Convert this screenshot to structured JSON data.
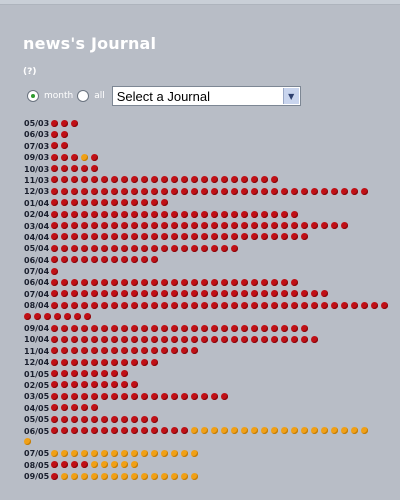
{
  "journal": {
    "title": "news's Journal",
    "help_link": "(?)",
    "filter": {
      "month_label": "month",
      "all_label": "all",
      "selected": "month"
    },
    "select": {
      "value": "Select a Journal"
    }
  },
  "colors": {
    "red": "#c01016",
    "orange": "#f0a016",
    "background": "#b8bdc6"
  },
  "rows": [
    {
      "date": "05/03",
      "red": 3,
      "orange": 0
    },
    {
      "date": "06/03",
      "red": 2,
      "orange": 0
    },
    {
      "date": "07/03",
      "red": 2,
      "orange": 0
    },
    {
      "date": "09/03",
      "red": 3,
      "orange": 1,
      "after_red": 1
    },
    {
      "date": "10/03",
      "red": 5,
      "orange": 0
    },
    {
      "date": "11/03",
      "red": 23,
      "orange": 0
    },
    {
      "date": "12/03",
      "red": 32,
      "orange": 0
    },
    {
      "date": "01/04",
      "red": 12,
      "orange": 0
    },
    {
      "date": "02/04",
      "red": 25,
      "orange": 0
    },
    {
      "date": "03/04",
      "red": 30,
      "orange": 0
    },
    {
      "date": "04/04",
      "red": 26,
      "orange": 0
    },
    {
      "date": "05/04",
      "red": 19,
      "orange": 0
    },
    {
      "date": "06/04",
      "red": 11,
      "orange": 0
    },
    {
      "date": "07/04",
      "red": 1,
      "orange": 0
    },
    {
      "date": "06/04",
      "red": 25,
      "orange": 0
    },
    {
      "date": "07/04",
      "red": 28,
      "orange": 0
    },
    {
      "date": "08/04",
      "red": 34,
      "orange": 0,
      "wrap_red": 7
    },
    {
      "date": "09/04",
      "red": 26,
      "orange": 0
    },
    {
      "date": "10/04",
      "red": 27,
      "orange": 0
    },
    {
      "date": "11/04",
      "red": 15,
      "orange": 0
    },
    {
      "date": "12/04",
      "red": 11,
      "orange": 0
    },
    {
      "date": "01/05",
      "red": 8,
      "orange": 0
    },
    {
      "date": "02/05",
      "red": 9,
      "orange": 0
    },
    {
      "date": "03/05",
      "red": 18,
      "orange": 0
    },
    {
      "date": "04/05",
      "red": 5,
      "orange": 0
    },
    {
      "date": "05/05",
      "red": 11,
      "orange": 0
    },
    {
      "date": "06/05",
      "red": 14,
      "orange": 18,
      "wrap_orange": 1
    },
    {
      "date": "07/05",
      "red": 0,
      "orange": 15
    },
    {
      "date": "08/05",
      "red": 4,
      "orange": 5
    },
    {
      "date": "09/05",
      "red": 1,
      "orange": 14
    }
  ]
}
